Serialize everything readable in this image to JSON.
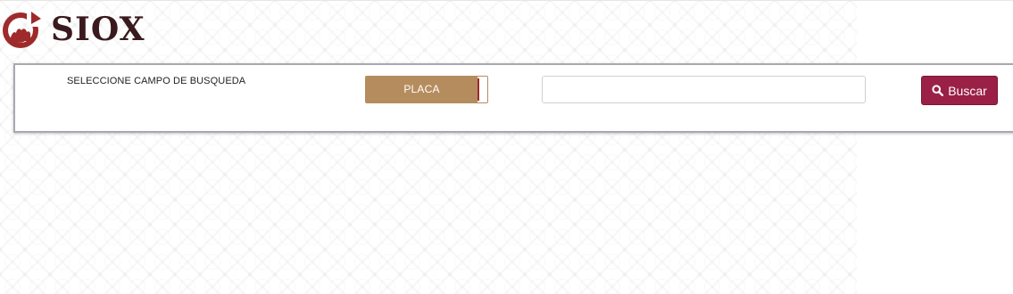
{
  "header": {
    "brand": "SIOX",
    "logo_icon": "siox-logo-icon"
  },
  "search": {
    "field_label": "SELECCIONE CAMPO DE BUSQUEDA",
    "field_toggle_label": "PLACA",
    "input_value": "",
    "input_placeholder": "",
    "button_label": "Buscar",
    "button_icon": "search-icon"
  },
  "colors": {
    "brand_dark": "#3a1a1f",
    "accent_maroon": "#9a2046",
    "toggle_tan": "#b58c5e",
    "panel_border": "#a9a8b0"
  }
}
